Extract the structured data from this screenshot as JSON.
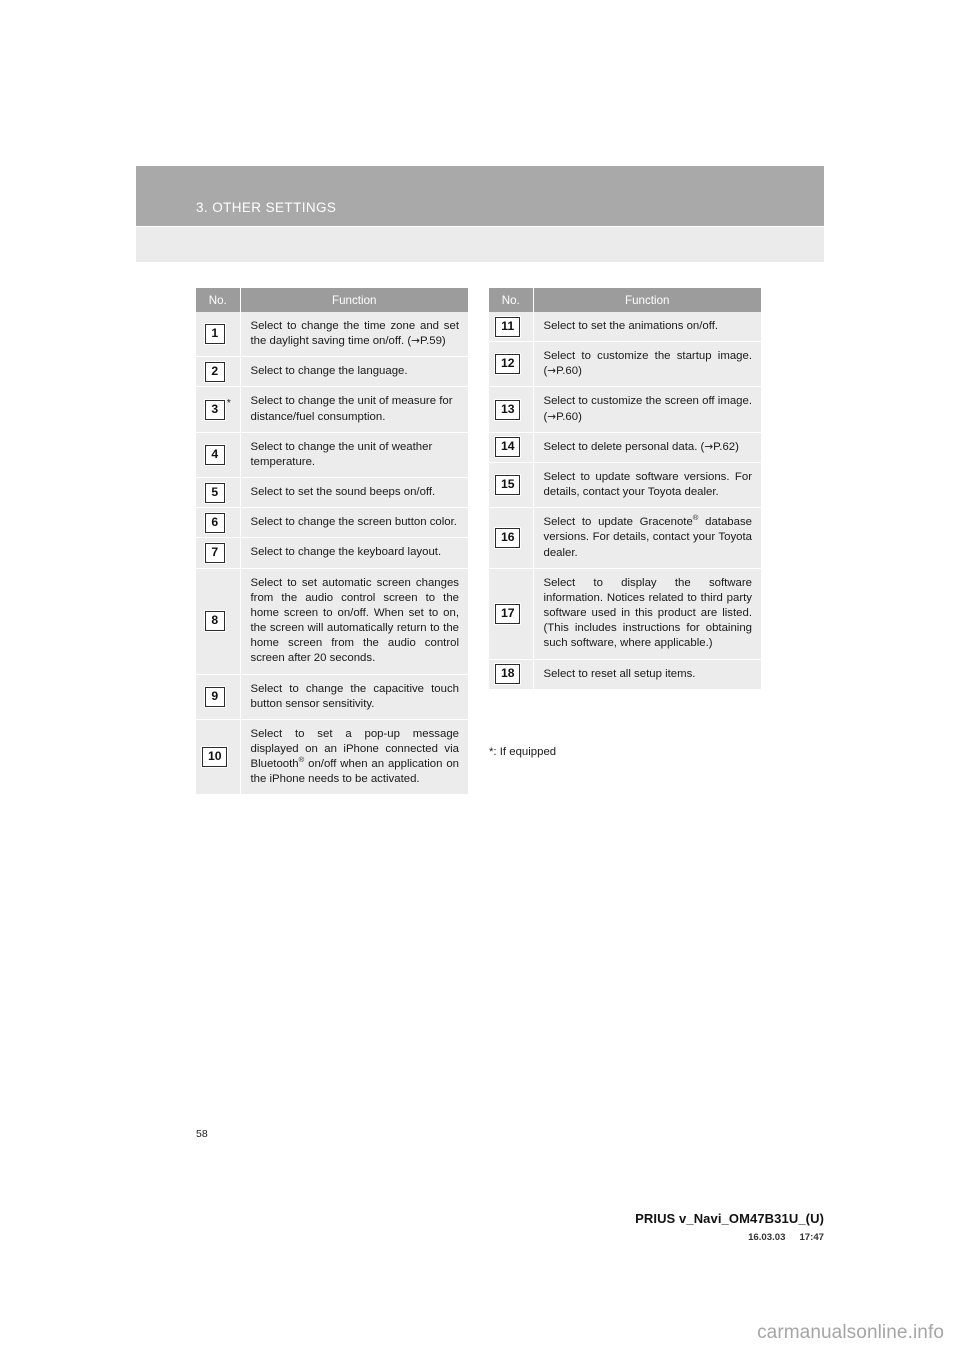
{
  "header": {
    "chapter_title": "3. OTHER SETTINGS"
  },
  "tables": {
    "columns": {
      "no": "No.",
      "function": "Function"
    },
    "left_rows": [
      {
        "no": "1",
        "starred": false,
        "justify": true,
        "text": "Select to change the time zone and set the daylight saving time on/off. (→P.59)"
      },
      {
        "no": "2",
        "starred": false,
        "justify": false,
        "text": "Select to change the language."
      },
      {
        "no": "3",
        "starred": true,
        "justify": false,
        "text": "Select to change the unit of measure for distance/fuel consumption."
      },
      {
        "no": "4",
        "starred": false,
        "justify": false,
        "text": "Select to change the unit of weather temperature."
      },
      {
        "no": "5",
        "starred": false,
        "justify": false,
        "text": "Select to set the sound beeps on/off."
      },
      {
        "no": "6",
        "starred": false,
        "justify": false,
        "text": "Select to change the screen button color."
      },
      {
        "no": "7",
        "starred": false,
        "justify": true,
        "text": "Select to change the keyboard layout."
      },
      {
        "no": "8",
        "starred": false,
        "justify": true,
        "text": "Select to set automatic screen changes from the audio control screen to the home screen to on/off. When set to on, the screen will automatically return to the home screen from the audio control screen after 20 seconds."
      },
      {
        "no": "9",
        "starred": false,
        "justify": true,
        "text": "Select to change the capacitive touch button sensor sensitivity."
      },
      {
        "no": "10",
        "starred": false,
        "justify": true,
        "text": "Select to set a pop-up message displayed on an iPhone connected via Bluetooth® on/off when an application on the iPhone needs to be activated."
      }
    ],
    "right_rows": [
      {
        "no": "11",
        "starred": false,
        "justify": false,
        "text": "Select to set the animations on/off."
      },
      {
        "no": "12",
        "starred": false,
        "justify": true,
        "text": "Select to customize the startup image. (→P.60)"
      },
      {
        "no": "13",
        "starred": false,
        "justify": true,
        "text": "Select to customize the screen off image. (→P.60)"
      },
      {
        "no": "14",
        "starred": false,
        "justify": true,
        "text": "Select to delete personal data. (→P.62)"
      },
      {
        "no": "15",
        "starred": false,
        "justify": true,
        "text": "Select to update software versions. For details, contact your Toyota dealer."
      },
      {
        "no": "16",
        "starred": false,
        "justify": true,
        "text": "Select to update Gracenote® database versions. For details, contact your Toyota dealer."
      },
      {
        "no": "17",
        "starred": false,
        "justify": true,
        "text": "Select to display the software information. Notices related to third party software used in this product are listed. (This includes instructions for obtaining such software, where applicable.)"
      },
      {
        "no": "18",
        "starred": false,
        "justify": false,
        "text": "Select to reset all setup items."
      }
    ]
  },
  "footnote": "*: If equipped",
  "footer": {
    "page_number": "58",
    "document_id": "PRIUS v_Navi_OM47B31U_(U)",
    "stamp_date": "16.03.03",
    "stamp_time": "17:47",
    "watermark": "carmanualsonline.info"
  },
  "colors": {
    "header_band": "#a9a9a9",
    "header_subband": "#ebebeb",
    "table_header": "#9c9c9c",
    "table_cell": "#ececec",
    "watermark": "#a5a5a5"
  }
}
